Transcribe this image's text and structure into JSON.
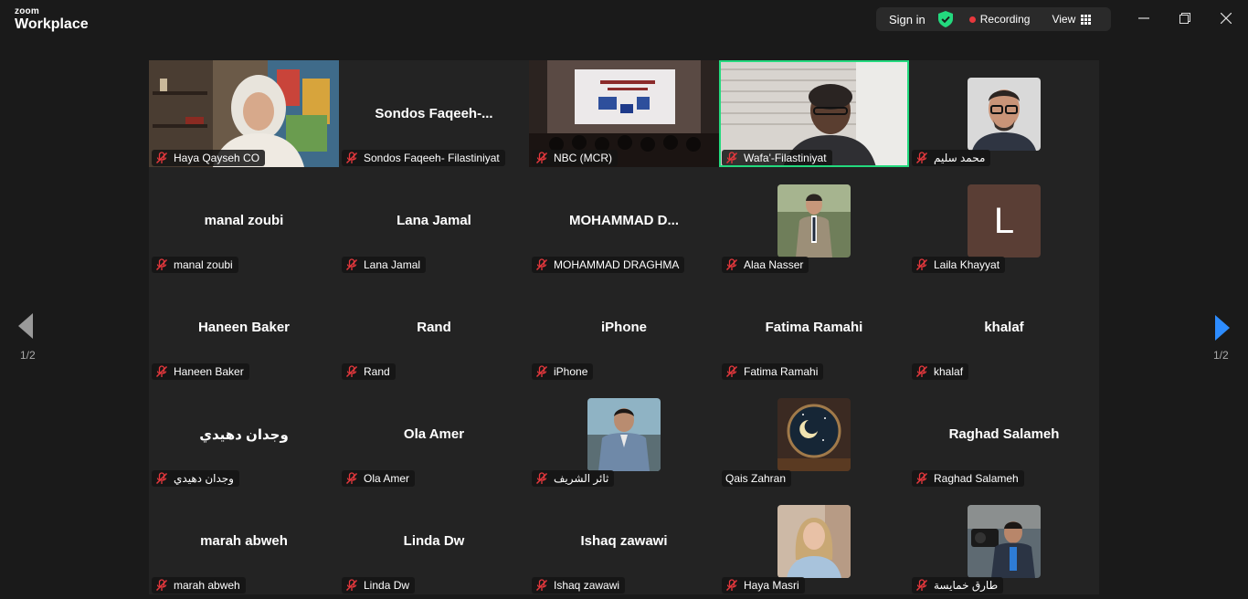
{
  "app": {
    "logo_line1": "zoom",
    "logo_line2": "Workplace"
  },
  "topbar": {
    "sign_in": "Sign in",
    "recording": "Recording",
    "view": "View"
  },
  "pager": {
    "left": "1/2",
    "right": "1/2"
  },
  "colors": {
    "accent": "#23d97e",
    "record": "#e8383d",
    "next_arrow": "#2d8cff"
  },
  "tiles": [
    {
      "label": "Haya Qayseh CO",
      "big": "",
      "kind": "video1"
    },
    {
      "label": "Sondos Faqeeh- Filastiniyat",
      "big": "Sondos  Faqeeh-...",
      "kind": "name"
    },
    {
      "label": "NBC (MCR)",
      "big": "",
      "kind": "video2"
    },
    {
      "label": "Wafa'-Filastiniyat",
      "big": "",
      "kind": "video3"
    },
    {
      "label": "محمد سليم",
      "big": "",
      "kind": "avatar1"
    },
    {
      "label": "manal zoubi",
      "big": "manal zoubi",
      "kind": "name"
    },
    {
      "label": "Lana Jamal",
      "big": "Lana Jamal",
      "kind": "name"
    },
    {
      "label": "MOHAMMAD DRAGHMA",
      "big": "MOHAMMAD  D...",
      "kind": "name"
    },
    {
      "label": "Alaa Nasser",
      "big": "",
      "kind": "avatar2"
    },
    {
      "label": "Laila Khayyat",
      "big": "",
      "kind": "letter",
      "letter": "L"
    },
    {
      "label": "Haneen Baker",
      "big": "Haneen Baker",
      "kind": "name"
    },
    {
      "label": "Rand",
      "big": "Rand",
      "kind": "name"
    },
    {
      "label": "iPhone",
      "big": "iPhone",
      "kind": "name"
    },
    {
      "label": "Fatima Ramahi",
      "big": "Fatima Ramahi",
      "kind": "name"
    },
    {
      "label": "khalaf",
      "big": "khalaf",
      "kind": "name"
    },
    {
      "label": "وجدان دهيدي",
      "big": "وجدان دهيدي",
      "kind": "name"
    },
    {
      "label": "Ola Amer",
      "big": "Ola Amer",
      "kind": "name"
    },
    {
      "label": "ثائر الشريف",
      "big": "",
      "kind": "avatar3"
    },
    {
      "label": "Qais Zahran",
      "big": "",
      "kind": "avatar4",
      "nomic": true
    },
    {
      "label": "Raghad Salameh",
      "big": "Raghad Salameh",
      "kind": "name"
    },
    {
      "label": "marah abweh",
      "big": "marah abweh",
      "kind": "name"
    },
    {
      "label": "Linda Dw",
      "big": "Linda Dw",
      "kind": "name"
    },
    {
      "label": "Ishaq zawawi",
      "big": "Ishaq zawawi",
      "kind": "name"
    },
    {
      "label": "Haya Masri",
      "big": "",
      "kind": "avatar5"
    },
    {
      "label": "طارق خمايسة",
      "big": "",
      "kind": "avatar6"
    }
  ]
}
